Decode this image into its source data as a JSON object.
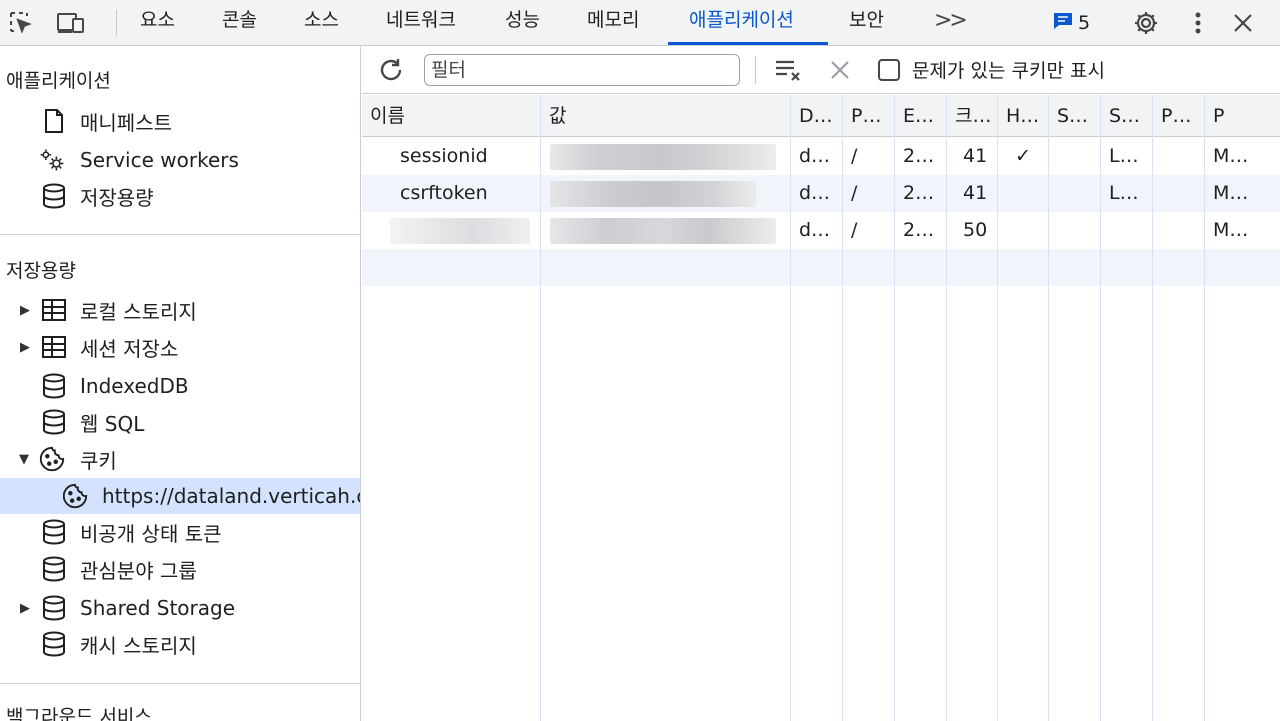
{
  "toolbar": {
    "tabs": [
      "요소",
      "콘솔",
      "소스",
      "네트워크",
      "성능",
      "메모리",
      "애플리케이션",
      "보안"
    ],
    "active_tab": "애플리케이션",
    "more_tabs": ">>",
    "issues_count": "5",
    "accent": "#0b57d0"
  },
  "sidebar": {
    "app_section": {
      "title": "애플리케이션",
      "items": [
        "매니페스트",
        "Service workers",
        "저장용량"
      ]
    },
    "storage_section": {
      "title": "저장용량",
      "items": [
        "로컬 스토리지",
        "세션 저장소",
        "IndexedDB",
        "웹 SQL",
        "쿠키",
        "https://dataland.verticah.c",
        "비공개 상태 토큰",
        "관심분야 그룹",
        "Shared Storage",
        "캐시 스토리지"
      ]
    },
    "bg_section": {
      "title": "백그라운드 서비스"
    }
  },
  "panel": {
    "filter_placeholder": "필터",
    "only_issues_label": "문제가 있는 쿠키만 표시"
  },
  "table": {
    "headers": [
      "이름",
      "값",
      "D…",
      "P…",
      "E…",
      "크…",
      "H…",
      "S…",
      "S…",
      "P…",
      "P"
    ],
    "rows": [
      {
        "name": "sessionid",
        "domain": "d…",
        "path": "/",
        "expires": "2…",
        "size": "41",
        "httponly": "✓",
        "secure": "",
        "samesite": "L…",
        "partition": "",
        "priority": "M…"
      },
      {
        "name": "csrftoken",
        "domain": "d…",
        "path": "/",
        "expires": "2…",
        "size": "41",
        "httponly": "",
        "secure": "",
        "samesite": "L…",
        "partition": "",
        "priority": "M…"
      },
      {
        "name": "",
        "domain": "d…",
        "path": "/",
        "expires": "2…",
        "size": "50",
        "httponly": "",
        "secure": "",
        "samesite": "",
        "partition": "",
        "priority": "M…"
      }
    ]
  }
}
